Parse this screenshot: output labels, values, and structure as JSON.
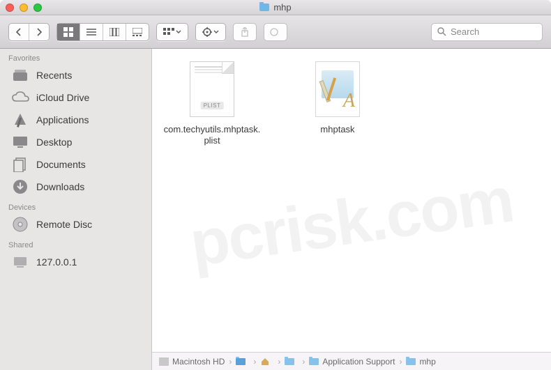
{
  "window": {
    "title": "mhp"
  },
  "toolbar": {
    "search_placeholder": "Search"
  },
  "sidebar": {
    "headings": {
      "favorites": "Favorites",
      "devices": "Devices",
      "shared": "Shared"
    },
    "favorites": [
      {
        "label": "Recents",
        "icon": "recents"
      },
      {
        "label": "iCloud Drive",
        "icon": "icloud"
      },
      {
        "label": "Applications",
        "icon": "applications"
      },
      {
        "label": "Desktop",
        "icon": "desktop"
      },
      {
        "label": "Documents",
        "icon": "documents"
      },
      {
        "label": "Downloads",
        "icon": "downloads"
      }
    ],
    "devices": [
      {
        "label": "Remote Disc",
        "icon": "disc"
      }
    ],
    "shared": [
      {
        "label": "127.0.0.1",
        "icon": "server"
      }
    ]
  },
  "files": [
    {
      "name": "com.techyutils.mhptask.plist",
      "kind": "plist"
    },
    {
      "name": "mhptask",
      "kind": "app-script"
    }
  ],
  "pathbar": [
    {
      "label": "Macintosh HD",
      "icon": "hd"
    },
    {
      "label": "",
      "icon": "folder"
    },
    {
      "label": "",
      "icon": "home"
    },
    {
      "label": "",
      "icon": "folder"
    },
    {
      "label": "Application Support",
      "icon": "folder"
    },
    {
      "label": "mhp",
      "icon": "folder"
    }
  ],
  "watermark": "pcrisk.com"
}
